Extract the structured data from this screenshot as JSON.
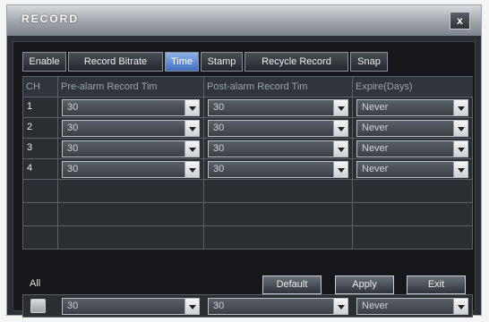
{
  "window": {
    "title": "RECORD",
    "close_glyph": "x"
  },
  "tabs": [
    {
      "label": "Enable",
      "active": false
    },
    {
      "label": "Record Bitrate",
      "active": false
    },
    {
      "label": "Time",
      "active": true
    },
    {
      "label": "Stamp",
      "active": false
    },
    {
      "label": "Recycle Record",
      "active": false
    },
    {
      "label": "Snap",
      "active": false
    }
  ],
  "table": {
    "headers": [
      "CH",
      "Pre-alarm Record Tim",
      "Post-alarm Record Tim",
      "Expire(Days)"
    ],
    "rows": [
      {
        "ch": "1",
        "pre": "30",
        "post": "30",
        "expire": "Never"
      },
      {
        "ch": "2",
        "pre": "30",
        "post": "30",
        "expire": "Never"
      },
      {
        "ch": "3",
        "pre": "30",
        "post": "30",
        "expire": "Never"
      },
      {
        "ch": "4",
        "pre": "30",
        "post": "30",
        "expire": "Never"
      }
    ]
  },
  "all": {
    "label": "All",
    "pre": "30",
    "post": "30",
    "expire": "Never"
  },
  "buttons": {
    "default": "Default",
    "apply": "Apply",
    "exit": "Exit"
  },
  "colors": {
    "active_tab": "#3e6fc0",
    "panel": "#15171a",
    "grid": "#2a2e33"
  }
}
